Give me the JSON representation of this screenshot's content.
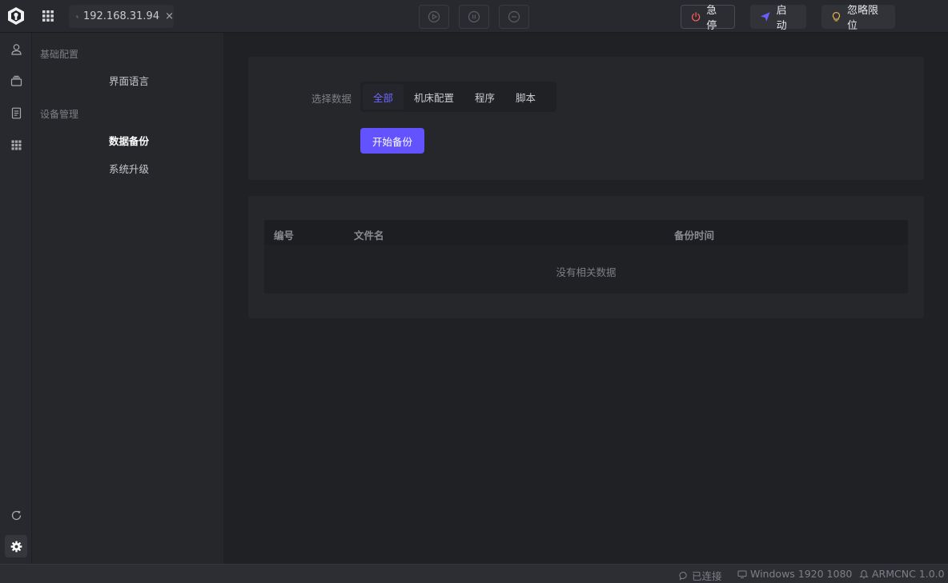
{
  "topbar": {
    "connection": "192.168.31.94",
    "close_symbol": "×",
    "estop_label": "急停",
    "start_label": "启动",
    "ignore_limit_label": "忽略限位"
  },
  "sidebar": {
    "groups": [
      {
        "title": "基础配置",
        "items": [
          "界面语言"
        ]
      },
      {
        "title": "设备管理",
        "items": [
          "数据备份",
          "系统升级"
        ]
      }
    ]
  },
  "main": {
    "select_label": "选择数据",
    "segments": [
      "全部",
      "机床配置",
      "程序",
      "脚本"
    ],
    "active_segment": "全部",
    "backup_button": "开始备份",
    "table": {
      "headers": [
        "编号",
        "文件名",
        "备份时间"
      ],
      "empty_text": "没有相关数据"
    }
  },
  "status": {
    "connected": "已连接",
    "system": "Windows 1920 1080",
    "version": "ARMCNC 1.0.0"
  },
  "colors": {
    "accent": "#6353ff",
    "estop_icon": "#ff5a5a",
    "start_icon": "#6b5cff",
    "ignore_icon": "#f2b64a",
    "background": "#202125"
  },
  "icons": {
    "rail": [
      "user-icon",
      "layers-icon",
      "document-icon",
      "apps-icon",
      "refresh-icon",
      "gear-icon"
    ],
    "controls": [
      "play-icon",
      "pause-icon",
      "stop-icon"
    ]
  }
}
